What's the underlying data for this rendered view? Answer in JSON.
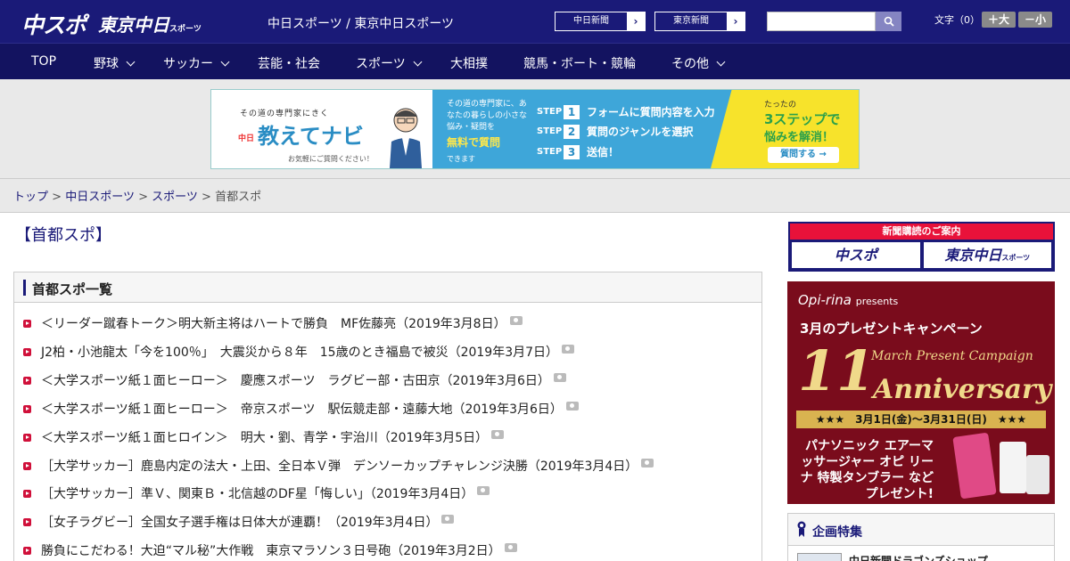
{
  "header": {
    "logo_chuspo": "中スポ",
    "logo_tokyo": "東京中日",
    "logo_tokyo_sub": "スポーツ",
    "site_title": "中日スポーツ / 東京中日スポーツ",
    "paper_links": [
      {
        "label": "中日新聞"
      },
      {
        "label": "東京新聞"
      }
    ],
    "search_placeholder": "",
    "font_size_label": "文字（0）",
    "font_bigger": "＋大",
    "font_smaller": "－小",
    "colors": {
      "header_bg": "#1a1a78",
      "nav_bg": "#131360"
    }
  },
  "nav": [
    {
      "label": "TOP",
      "dropdown": false
    },
    {
      "label": "野球",
      "dropdown": true
    },
    {
      "label": "サッカー",
      "dropdown": true
    },
    {
      "label": "芸能・社会",
      "dropdown": false
    },
    {
      "label": "スポーツ",
      "dropdown": true
    },
    {
      "label": "大相撲",
      "dropdown": false
    },
    {
      "label": "競馬・ボート・競輪",
      "dropdown": false
    },
    {
      "label": "その他",
      "dropdown": true
    }
  ],
  "banner": {
    "tag": "その道の専門家にきく",
    "logo_prefix": "中日",
    "logo": "教えてナビ",
    "note": "お気軽にご質問ください！",
    "desc": "その道の専門家に、あなたの暮らしの小さな悩み・疑問を",
    "free": "無料で質問",
    "dekimasu": "できます",
    "steps": [
      {
        "step": "STEP",
        "num": "1",
        "text": "フォームに質問内容を入力"
      },
      {
        "step": "STEP",
        "num": "2",
        "text": "質問のジャンルを選択"
      },
      {
        "step": "STEP",
        "num": "3",
        "text": "送信！"
      }
    ],
    "right_small": "たったの",
    "right_big": "3ステップで",
    "right_sub": "悩みを解消！",
    "cta": "質問する →"
  },
  "breadcrumb": {
    "items": [
      "トップ",
      "中日スポーツ",
      "スポーツ"
    ],
    "current": "首都スポ",
    "sep": ">"
  },
  "main": {
    "page_title": "【首都スポ】",
    "list_title": "首都スポ一覧",
    "articles": [
      {
        "title": "＜リーダー蹴春トーク＞明大新主将はハートで勝負　MF佐藤亮（2019年3月8日）"
      },
      {
        "title": "J2柏・小池龍太「今を100％」　大震災から８年　15歳のとき福島で被災（2019年3月7日）"
      },
      {
        "title": "＜大学スポーツ紙１面ヒーロー＞　慶應スポーツ　ラグビー部・古田京（2019年3月6日）"
      },
      {
        "title": "＜大学スポーツ紙１面ヒーロー＞　帝京スポーツ　駅伝競走部・遠藤大地（2019年3月6日）"
      },
      {
        "title": "＜大学スポーツ紙１面ヒロイン＞　明大・劉、青学・宇治川（2019年3月5日）"
      },
      {
        "title": "［大学サッカー］鹿島内定の法大・上田、全日本Ｖ弾　デンソーカップチャレンジ決勝（2019年3月4日）"
      },
      {
        "title": "［大学サッカー］準Ｖ、関東Ｂ・北信越のDF星「悔しい」（2019年3月4日）"
      },
      {
        "title": "［女子ラグビー］全国女子選手権は日体大が連覇！（2019年3月4日）"
      },
      {
        "title": "勝負にこだわる！大迫“マル秘”大作戦　東京マラソン３日号砲（2019年3月2日）"
      }
    ]
  },
  "sidebar": {
    "subscribe_head": "新聞購読のご案内",
    "subscribe_logo1": "中スポ",
    "subscribe_logo2": "東京中日",
    "subscribe_logo2_sub": "スポーツ",
    "promo": {
      "brand": "Opi-rina",
      "brand_sub": "presents",
      "headline": "3月のプレゼントキャンペーン",
      "big": "11",
      "mpc": "March Present Campaign",
      "anniv": "Anniversary",
      "period": "★★★　3月1日(金)〜3月31日(日)　★★★",
      "prize": "パナソニック エアーマッサージャー オピ リーナ 特製タンブラー などプレゼント!"
    },
    "feature_title": "企画特集",
    "feature_item": "中日新聞ドラゴンズショップ"
  }
}
